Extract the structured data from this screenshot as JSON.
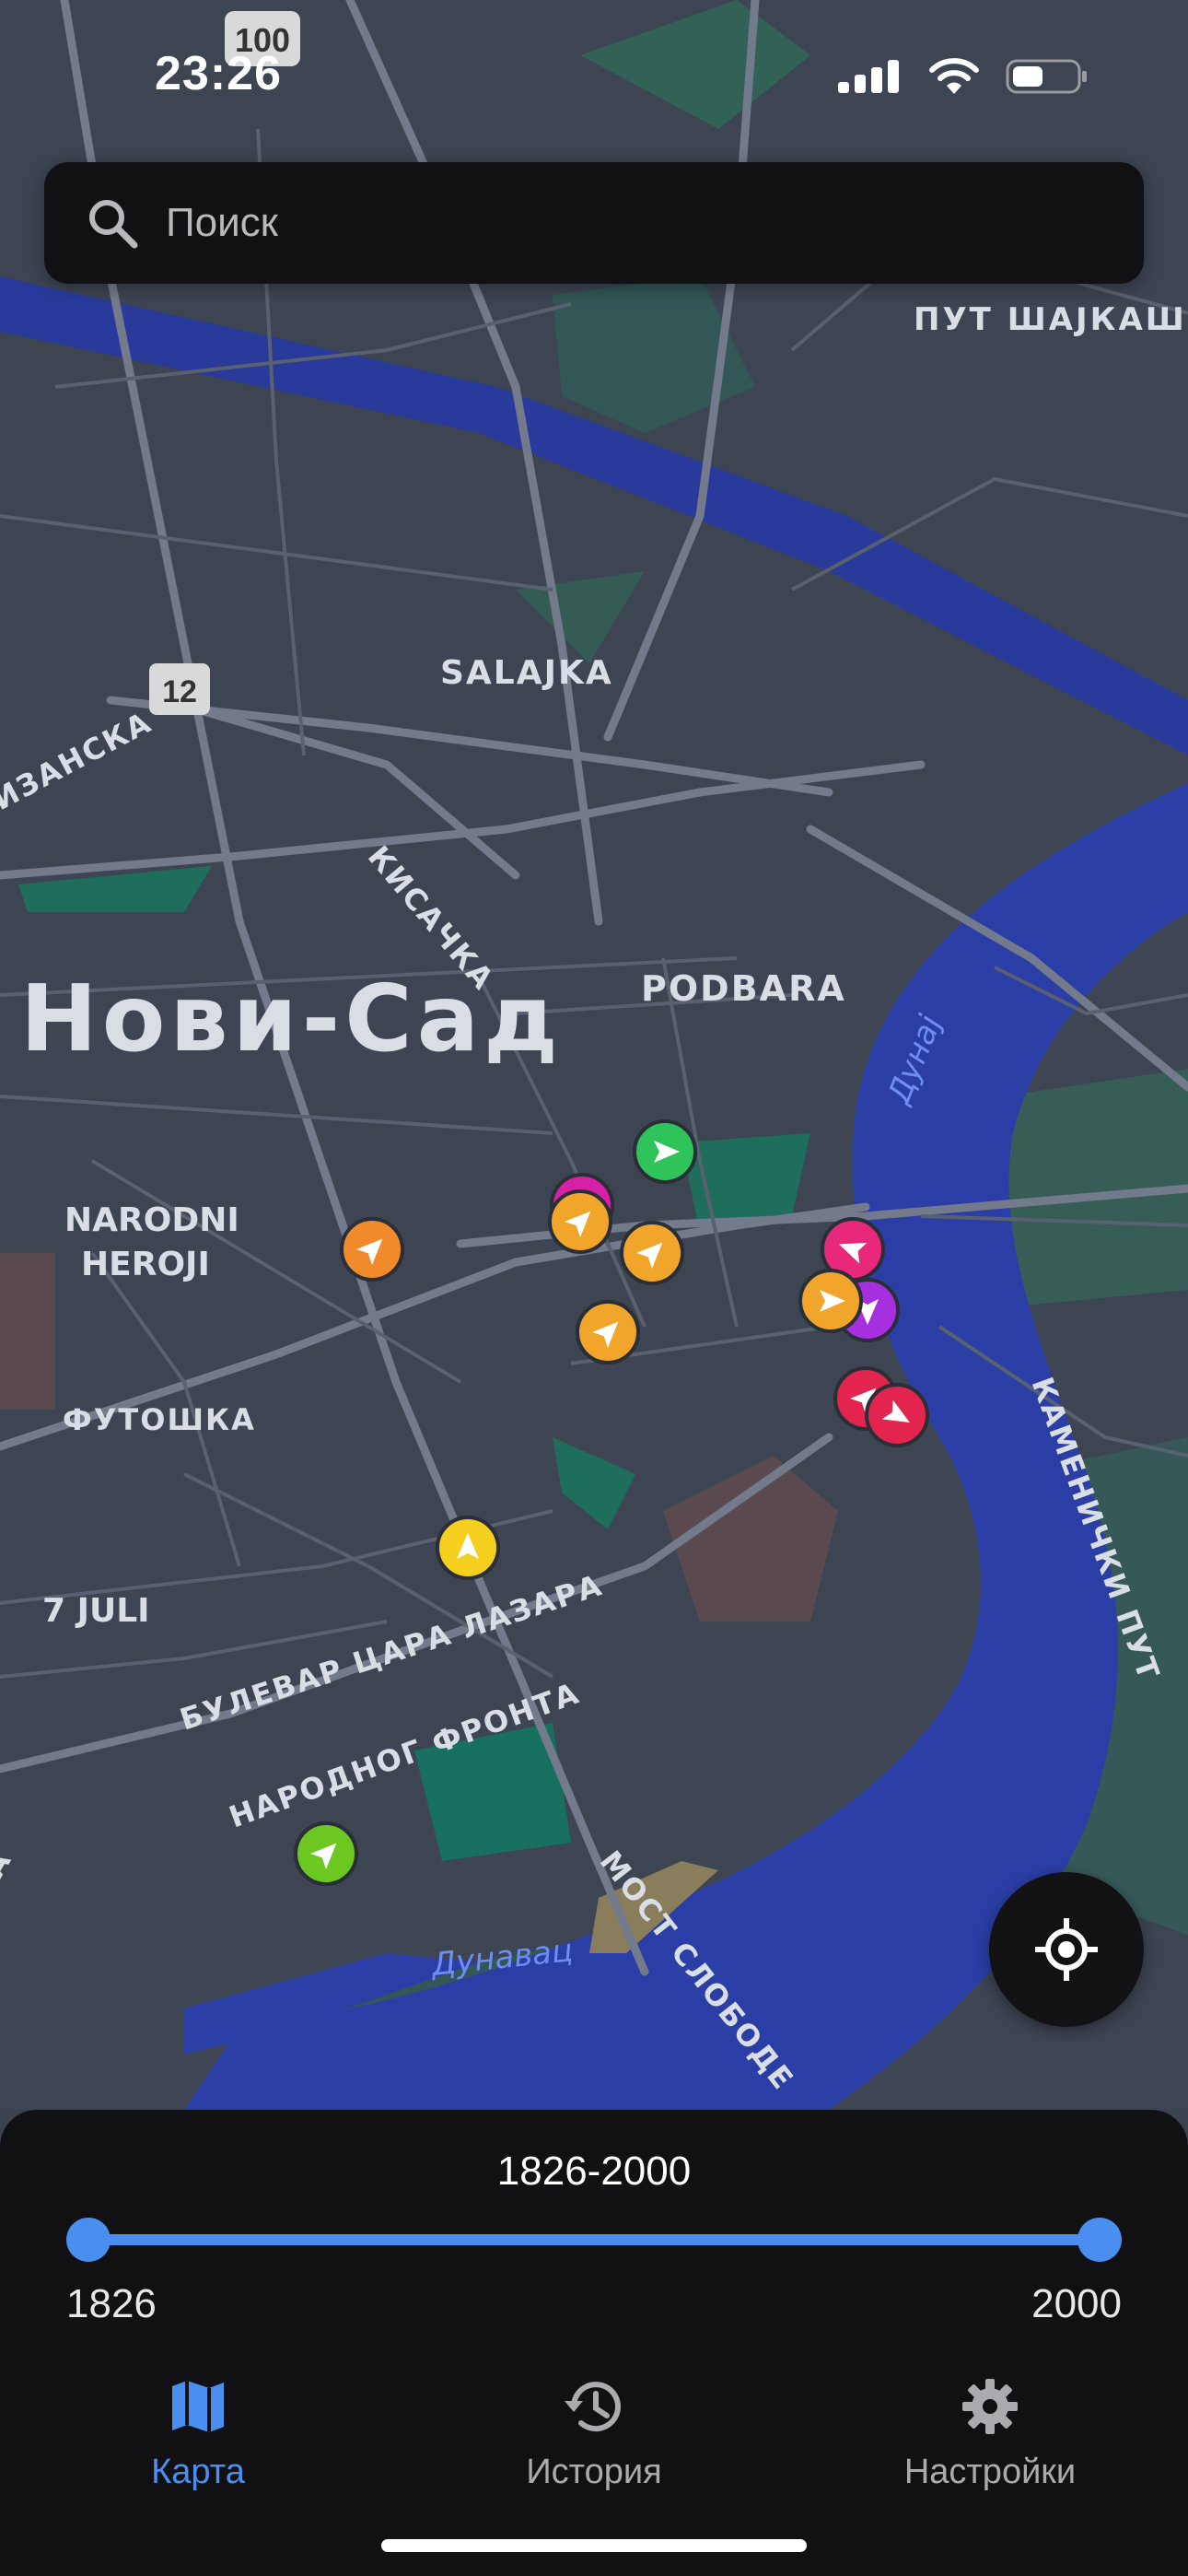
{
  "status_bar": {
    "time": "23:26",
    "route_badge": "100"
  },
  "search": {
    "placeholder": "Поиск"
  },
  "map": {
    "city_label": "Нови-Сад",
    "labels": {
      "put_sajkaski": "ПУТ ШАЈКАШКО",
      "salajka": "SALAJKA",
      "route_12": "12",
      "bizanska": "ИЗАНСКА",
      "kisacka": "КИСАЧКА",
      "podbara": "PODBARA",
      "dunav": "Дунај",
      "narodni": "NARODNI",
      "heroji": "HEROJI",
      "futoska": "ФУТОШКА",
      "kamenicki": "КАМЕНИЧКИ ПУТ",
      "juli7": "7 JULI",
      "car_lazar": "БУЛЕВАР ЦАРА ЛАЗАРА",
      "narodnog_fronta": "НАРОДНОГ ФРОНТА",
      "most_slobode": "МОСТ СЛОБОДЕ",
      "dunavac": "Дунавац",
      "edge_a": "А"
    },
    "marker_colors": {
      "orange": "#f08a2b",
      "amber": "#f2a52b",
      "green": "#2ec45a",
      "lime": "#6cc720",
      "yellow": "#f4cf1e",
      "pink": "#e8287a",
      "red": "#e3244e",
      "purple": "#a62fe0",
      "magenta": "#d81fa8"
    }
  },
  "range": {
    "title": "1826-2000",
    "min": "1826",
    "max": "2000",
    "selected_start_fraction": 0,
    "selected_end_fraction": 1
  },
  "tabs": [
    {
      "label": "Карта",
      "icon": "map-icon",
      "active": true
    },
    {
      "label": "История",
      "icon": "history-icon",
      "active": false
    },
    {
      "label": "Настройки",
      "icon": "gear-icon",
      "active": false
    }
  ],
  "colors": {
    "accent": "#4a8ff0",
    "sheet": "#111113",
    "map_land": "#3b4250",
    "water": "#2a3a9a"
  }
}
